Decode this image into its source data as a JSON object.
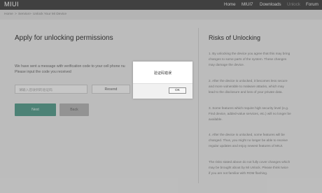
{
  "nav": {
    "logo": "MIUI",
    "items": [
      "Home",
      "MIUI7",
      "Downloads",
      "Unlock",
      "Forum"
    ],
    "active_index": 3
  },
  "breadcrumb": {
    "items": [
      "Home",
      ">",
      "Service",
      ">",
      "Unlock Your Mi Device"
    ]
  },
  "main": {
    "title": "Apply for unlocking permissions",
    "message_line1": "We have sent a message with verification code to your cell phone nu",
    "message_line2": "Please input the code you received",
    "code_placeholder": "请输入您收到的验证码",
    "resend_label": "Resend",
    "next_label": "Next",
    "back_label": "Back"
  },
  "risks": {
    "title": "Risks of Unlocking",
    "lines": [
      "1. By unlocking the device you agree that this may bring",
      "changes to some parts of the system. These changes",
      "may damage the device.",
      "2. After the device is unlocked, it becomes less secure",
      "and more vulnerable to malware attacks, which may",
      "lead to the disclosure and loss of your private data.",
      "3. Some features which require high security level (e.g.",
      "Find device, added-value services, etc.) will no longer be",
      "available.",
      "4. After the device is unlocked, some features will be",
      "changed. Thus, you might no longer be able to receive",
      "regular updates and enjoy newest features of MIUI.",
      "The risks stated above do not fully cover changes which",
      "may be brought about by Mi Unlock. Please think twice",
      "if you are not familiar with ROM flashing."
    ]
  },
  "dialog": {
    "message": "验证码错误",
    "ok_label": "OK"
  }
}
